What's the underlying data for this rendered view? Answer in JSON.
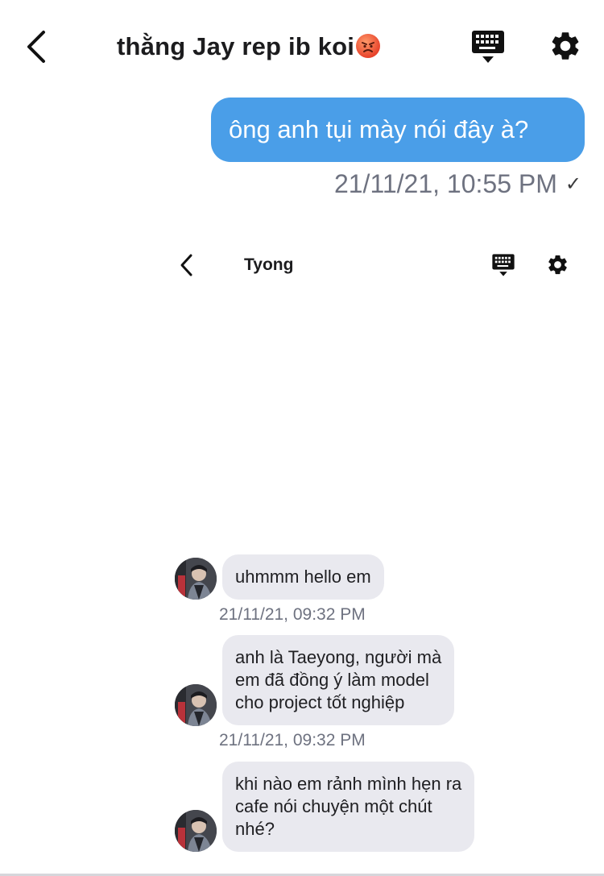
{
  "header": {
    "title": "thằng Jay rep ib koi",
    "title_emoji": "angry-face-emoji",
    "back_icon": "chevron-left-icon",
    "keyboard_icon": "keyboard-icon",
    "settings_icon": "gear-icon"
  },
  "sent_message": {
    "text": "ông anh tụi mày nói đây à?",
    "timestamp": "21/11/21, 10:55 PM",
    "status": "✓",
    "bubble_color": "#4a9ee8"
  },
  "inner_screenshot": {
    "header": {
      "title": "Tyong",
      "back_icon": "chevron-left-icon",
      "keyboard_icon": "keyboard-icon",
      "settings_icon": "gear-icon"
    },
    "messages": [
      {
        "lines": [
          "uhmmm hello em"
        ],
        "timestamp": "21/11/21, 09:32 PM"
      },
      {
        "lines": [
          "anh là Taeyong, người mà",
          "em đã đồng ý làm model",
          "cho project tốt nghiệp"
        ],
        "timestamp": "21/11/21, 09:32 PM"
      },
      {
        "lines": [
          "khi nào em rảnh mình hẹn ra",
          "cafe nói chuyện một chút",
          "nhé?"
        ]
      }
    ],
    "bubble_color": "#e9e9ef"
  }
}
